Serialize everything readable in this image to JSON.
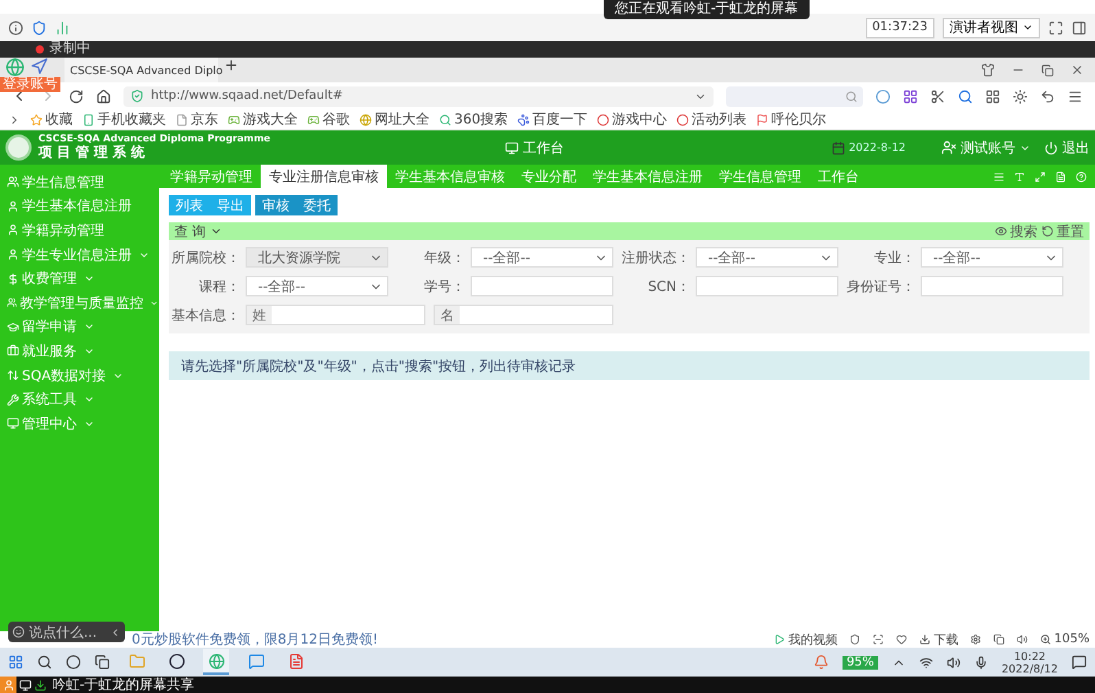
{
  "screen_share_notice": {
    "text": "您正在观看吟虹-于虹龙的屏幕"
  },
  "meeting_bar": {
    "timer": "01:37:23",
    "view_button": "演讲者视图"
  },
  "recording": {
    "label": "录制中"
  },
  "browser": {
    "account_badge": "登录账号",
    "tab_title": "CSCSE-SQA Advanced Diplo",
    "address": "http://www.sqaad.net/Default#"
  },
  "bookmarks": [
    {
      "kind": "star",
      "label": "收藏"
    },
    {
      "kind": "phone",
      "label": "手机收藏夹"
    },
    {
      "kind": "page",
      "label": "京东"
    },
    {
      "kind": "game",
      "label": "游戏大全"
    },
    {
      "kind": "game",
      "label": "谷歌"
    },
    {
      "kind": "globe",
      "label": "网址大全"
    },
    {
      "kind": "search",
      "label": "360搜索"
    },
    {
      "kind": "paw",
      "label": "百度一下"
    },
    {
      "kind": "circle",
      "label": "游戏中心"
    },
    {
      "kind": "circle",
      "label": "活动列表"
    },
    {
      "kind": "flag",
      "label": "呼伦贝尔"
    }
  ],
  "app_header": {
    "title_en": "CSCSE-SQA Advanced Diploma Programme",
    "title_cn": "项 目 管 理 系 统",
    "workbench": "工作台",
    "date": "2022-8-12",
    "account": "测试账号",
    "logout": "退出"
  },
  "sidebar": {
    "items": [
      {
        "label": "学生信息管理",
        "expandable": false
      },
      {
        "label": "学生基本信息注册",
        "expandable": false
      },
      {
        "label": "学籍异动管理",
        "expandable": false
      },
      {
        "label": "学生专业信息注册",
        "expandable": true
      },
      {
        "label": "收费管理",
        "expandable": true
      },
      {
        "label": "教学管理与质量监控",
        "expandable": true
      },
      {
        "label": "留学申请",
        "expandable": true
      },
      {
        "label": "就业服务",
        "expandable": true
      },
      {
        "label": "SQA数据对接",
        "expandable": true
      },
      {
        "label": "系统工具",
        "expandable": true
      },
      {
        "label": "管理中心",
        "expandable": true
      }
    ]
  },
  "tabs": [
    {
      "label": "学籍异动管理",
      "selected": false
    },
    {
      "label": "专业注册信息审核",
      "selected": true
    },
    {
      "label": "学生基本信息审核",
      "selected": false
    },
    {
      "label": "专业分配",
      "selected": false
    },
    {
      "label": "学生基本信息注册",
      "selected": false
    },
    {
      "label": "学生信息管理",
      "selected": false
    },
    {
      "label": "工作台",
      "selected": false
    }
  ],
  "button_groups": [
    {
      "kind": "light",
      "buttons": [
        "列表",
        "导出"
      ]
    },
    {
      "kind": "dark",
      "buttons": [
        "审核",
        "委托"
      ]
    }
  ],
  "query": {
    "title": "查 询",
    "search": "搜索",
    "reset": "重置",
    "rows": [
      [
        {
          "kind": "select",
          "label": "所属院校：",
          "value": "北大资源学院",
          "disabled": true
        },
        {
          "kind": "select",
          "label": "年级：",
          "value": "--全部--",
          "disabled": false
        },
        {
          "kind": "select",
          "label": "注册状态：",
          "value": "--全部--",
          "disabled": false
        },
        {
          "kind": "select",
          "label": "专业：",
          "value": "--全部--",
          "disabled": false
        }
      ],
      [
        {
          "kind": "select",
          "label": "课程：",
          "value": "--全部--",
          "disabled": false
        },
        {
          "kind": "input",
          "label": "学号："
        },
        {
          "kind": "input",
          "label": "SCN："
        },
        {
          "kind": "input",
          "label": "身份证号："
        }
      ],
      [
        {
          "kind": "name",
          "label": "基本信息：",
          "addons": [
            "姓",
            "名"
          ]
        }
      ]
    ]
  },
  "notice": "请先选择\"所属院校\"及\"年级\"，点击\"搜索\"按钮，列出待审核记录",
  "chat": {
    "placeholder": "说点什么..."
  },
  "status_bar": {
    "ad": "0元炒股软件免费领，限8月12日免费领!",
    "my_video": "我的视频",
    "download": "下载",
    "zoom": "105%"
  },
  "taskbar": {
    "apps": [
      {
        "kind": "folder",
        "selected": false
      },
      {
        "kind": "ring",
        "selected": false
      },
      {
        "kind": "browser",
        "selected": true
      },
      {
        "kind": "chat",
        "selected": false
      },
      {
        "kind": "wps",
        "selected": false
      }
    ],
    "battery": "95%",
    "time": "10:22",
    "date": "2022/8/12"
  },
  "share_bar": {
    "text": "吟虹-于虹龙的屏幕共享"
  }
}
